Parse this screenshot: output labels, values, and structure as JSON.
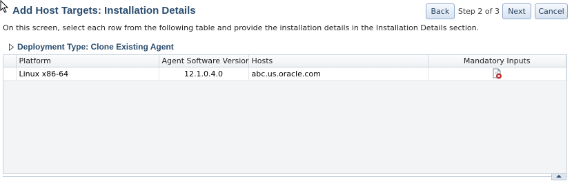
{
  "header": {
    "title": "Add Host Targets: Installation Details",
    "back_label": "Back",
    "step_text": "Step 2 of 3",
    "next_label": "Next",
    "cancel_label": "Cancel"
  },
  "instructions": "On this screen, select each row from the following table and provide the installation details in the Installation Details section.",
  "section": {
    "title": "Deployment Type: Clone Existing Agent"
  },
  "table": {
    "columns": [
      "Platform",
      "Agent Software Version",
      "Hosts",
      "Mandatory Inputs"
    ],
    "rows": [
      {
        "platform": "Linux x86-64",
        "version": "12.1.0.4.0",
        "hosts": "abc.us.oracle.com",
        "mandatory_inputs_icon": "document-error-icon"
      }
    ]
  },
  "colors": {
    "title": "#2a4c6e",
    "button_border": "#93aacb",
    "error": "#d0262a"
  }
}
